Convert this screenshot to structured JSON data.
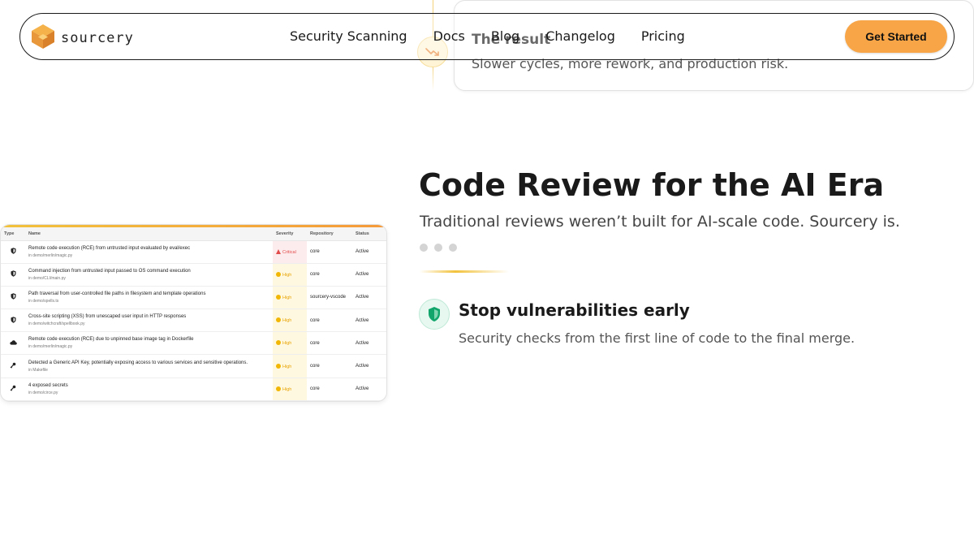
{
  "brand": {
    "name": "sourcery"
  },
  "nav": {
    "links": [
      "Security Scanning",
      "Docs",
      "Blog",
      "Changelog",
      "Pricing"
    ],
    "cta": "Get Started"
  },
  "result_card": {
    "title": "The result",
    "text": "Slower cycles, more rework, and production risk."
  },
  "hero": {
    "title": "Code Review for the AI Era",
    "subtitle": "Traditional reviews weren’t built for AI-scale code. Sourcery is."
  },
  "feature": {
    "title": "Stop vulnerabilities early",
    "description": "Security checks from the first line of code to the final merge."
  },
  "findings_table": {
    "headers": [
      "Type",
      "Name",
      "Severity",
      "Repository",
      "Status"
    ],
    "rows": [
      {
        "type_icon": "shield-icon",
        "name": "Remote code execution (RCE) from untrusted input evaluated by eval/exec",
        "path": "in demo/merlin/magic.py",
        "severity": "Critical",
        "severity_kind": "critical",
        "repository": "core",
        "status": "Active"
      },
      {
        "type_icon": "shield-icon",
        "name": "Command injection from untrusted input passed to OS command execution",
        "path": "in demo/CLI/main.py",
        "severity": "High",
        "severity_kind": "high",
        "repository": "core",
        "status": "Active"
      },
      {
        "type_icon": "shield-icon",
        "name": "Path traversal from user-controlled file paths in filesystem and template operations",
        "path": "in demo/spells.ts",
        "severity": "High",
        "severity_kind": "high",
        "repository": "sourcery-vscode",
        "status": "Active"
      },
      {
        "type_icon": "shield-icon",
        "name": "Cross-site scripting (XSS) from unescaped user input in HTTP responses",
        "path": "in demo/witchcraft/spellbook.py",
        "severity": "High",
        "severity_kind": "high",
        "repository": "core",
        "status": "Active"
      },
      {
        "type_icon": "cloud-icon",
        "name": "Remote code execution (RCE) due to unpinned base image tag in Dockerfile",
        "path": "in demo/merlin/magic.py",
        "severity": "High",
        "severity_kind": "high",
        "repository": "core",
        "status": "Active"
      },
      {
        "type_icon": "key-icon",
        "name": "Detected a Generic API Key, potentially exposing access to various services and sensitive operations.",
        "path": "in Makefile",
        "severity": "High",
        "severity_kind": "high",
        "repository": "core",
        "status": "Active"
      },
      {
        "type_icon": "key-icon",
        "name": "4 exposed secrets",
        "path": "in demo/circe.py",
        "severity": "High",
        "severity_kind": "high",
        "repository": "core",
        "status": "Active"
      }
    ]
  },
  "colors": {
    "accent": "#f7a546",
    "critical": "#e24b4b",
    "high": "#f2b705",
    "feature_icon": "#12a56b"
  }
}
